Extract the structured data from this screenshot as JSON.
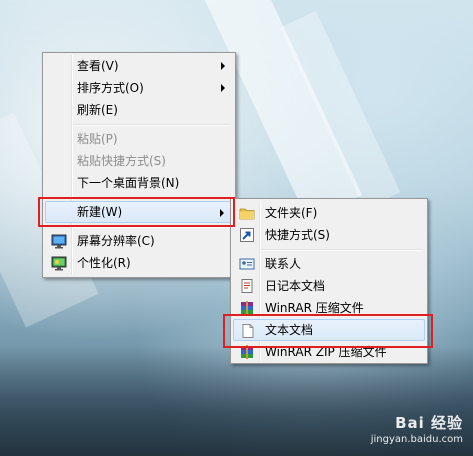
{
  "context_menu": {
    "items": [
      {
        "label": "查看(V)"
      },
      {
        "label": "排序方式(O)"
      },
      {
        "label": "刷新(E)"
      },
      {
        "label": "粘贴(P)"
      },
      {
        "label": "粘贴快捷方式(S)"
      },
      {
        "label": "下一个桌面背景(N)"
      },
      {
        "label": "新建(W)"
      },
      {
        "label": "屏幕分辨率(C)"
      },
      {
        "label": "个性化(R)"
      }
    ]
  },
  "new_submenu": {
    "items": [
      {
        "label": "文件夹(F)"
      },
      {
        "label": "快捷方式(S)"
      },
      {
        "label": "联系人"
      },
      {
        "label": "日记本文档"
      },
      {
        "label": "WinRAR 压缩文件"
      },
      {
        "label": "文本文档"
      },
      {
        "label": "WinRAR ZIP 压缩文件"
      }
    ]
  },
  "watermark": {
    "brand": "Bai 经验",
    "url": "jingyan.baidu.com"
  },
  "colors": {
    "highlight_border": "#e02020",
    "menu_highlight": "#dbe9f8"
  }
}
